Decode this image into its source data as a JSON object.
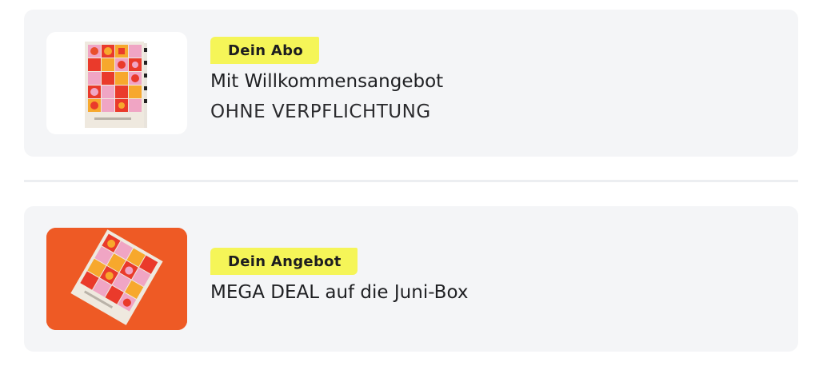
{
  "cards": [
    {
      "badge": "Dein Abo",
      "title": "Mit Willkommensangebot",
      "subtitle": "OHNE VERPFLICHTUNG",
      "image_icon": "product-box-icon"
    },
    {
      "badge": "Dein Angebot",
      "title": "MEGA DEAL auf die Juni-Box",
      "image_icon": "product-box-icon"
    }
  ],
  "colors": {
    "card_background": "#f4f5f7",
    "badge_background": "#f5f558",
    "offer_image_background": "#ee5a25"
  }
}
